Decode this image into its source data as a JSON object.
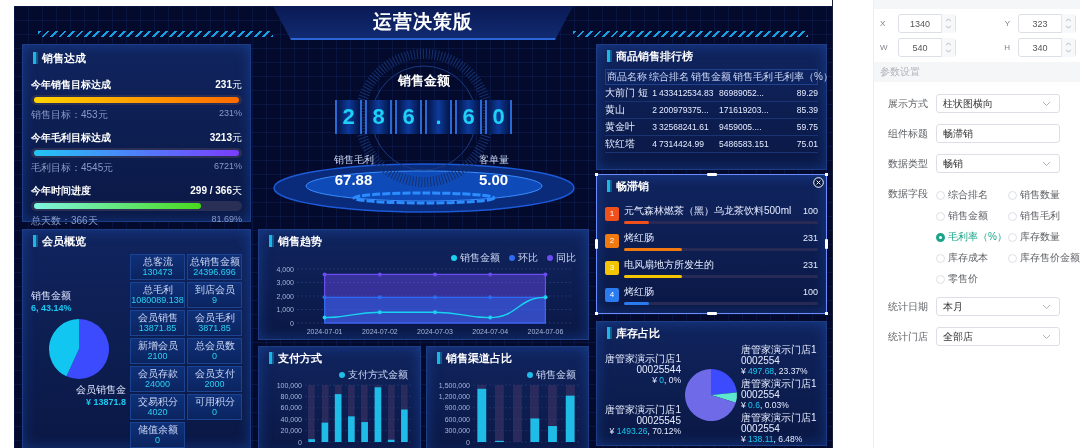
{
  "title": "运营决策版",
  "sales_achievement": {
    "title": "销售达成",
    "items": [
      {
        "kind": "sales",
        "label": "今年销售目标达成",
        "value": "231",
        "unit": "元",
        "target": "销售目标：453元",
        "percent": "231%",
        "level": 1
      },
      {
        "kind": "profit",
        "label": "今年毛利目标达成",
        "value": "3213",
        "unit": "元",
        "target": "毛利目标：4545元",
        "percent": "6721%",
        "level": 1
      },
      {
        "kind": "time",
        "label": "今年时间进度",
        "value": "299 / 366",
        "unit": "天",
        "target": "总天数：366天",
        "percent": "81.69%",
        "level": 0.8169
      }
    ]
  },
  "member_overview": {
    "title": "会员概览",
    "chart_data": {
      "type": "pie",
      "values": [
        56.86,
        43.14
      ]
    },
    "pie_labels": [
      {
        "name": "销售金额",
        "value": "6, 43.14%"
      },
      {
        "name": "会员销售金",
        "value": "¥ 13871.8"
      }
    ],
    "stats": [
      {
        "label": "总客流",
        "value": "130473"
      },
      {
        "label": "总销售金额",
        "value": "24396.696"
      },
      {
        "label": "总毛利",
        "value": "1080089.138"
      },
      {
        "label": "到店会员",
        "value": "9"
      },
      {
        "label": "会员销售",
        "value": "13871.85"
      },
      {
        "label": "会员毛利",
        "value": "3871.85"
      },
      {
        "label": "新增会员",
        "value": "2100"
      },
      {
        "label": "总会员数",
        "value": "0"
      },
      {
        "label": "会员存款",
        "value": "24000"
      },
      {
        "label": "会员支付",
        "value": "2000"
      },
      {
        "label": "交易积分",
        "value": "4020"
      },
      {
        "label": "可用积分",
        "value": "0"
      },
      {
        "label": "储值余额",
        "value": "0"
      }
    ]
  },
  "gauge": {
    "title": "销售金额",
    "digits": [
      "2",
      "8",
      "6",
      ".",
      "6",
      "0"
    ],
    "metrics": [
      {
        "label": "销售毛利",
        "value": "67.88"
      },
      {
        "label": "客单量",
        "value": "5.00"
      }
    ]
  },
  "sales_trend": {
    "title": "销售趋势",
    "chart_data": {
      "type": "area",
      "grid": true,
      "categories": [
        "2024-07-01",
        "2024-07-02",
        "2024-07-03",
        "2024-07-04",
        "2024-07-06"
      ],
      "ylim": [
        0,
        4000
      ],
      "yticks": [
        {
          "value": 0,
          "label": "0"
        },
        {
          "value": 1000,
          "label": "1,000"
        },
        {
          "value": 2000,
          "label": "2,000"
        },
        {
          "value": 3000,
          "label": "3,000"
        },
        {
          "value": 4000,
          "label": "4,000"
        }
      ],
      "series": [
        {
          "name": "销售金额",
          "type": "line",
          "color": "#19d3f0",
          "values": [
            400,
            800,
            800,
            400,
            1900
          ]
        },
        {
          "name": "环比",
          "type": "area",
          "color": "#2f6bf2",
          "values": [
            1900,
            1900,
            1900,
            1900,
            1900
          ]
        },
        {
          "name": "同比",
          "type": "area",
          "color": "#6a4cf0",
          "values": [
            3600,
            3600,
            3600,
            3600,
            3600
          ]
        }
      ]
    }
  },
  "payment": {
    "title": "支付方式",
    "chart_data": {
      "type": "bar",
      "grid": true,
      "ylim": [
        0,
        100000
      ],
      "yticks": [
        {
          "value": 0,
          "label": "0"
        },
        {
          "value": 20000,
          "label": "20,000"
        },
        {
          "value": 40000,
          "label": "40,000"
        },
        {
          "value": 60000,
          "label": "60,000"
        },
        {
          "value": 80000,
          "label": "80,000"
        },
        {
          "value": 100000,
          "label": "100,000"
        }
      ],
      "series": [
        {
          "name": "支付方式金额",
          "color": "#1fbce8",
          "values": [
            5000,
            34000,
            84000,
            45000,
            35000,
            96000,
            4000,
            57000
          ]
        }
      ]
    }
  },
  "channel": {
    "title": "销售渠道占比",
    "chart_data": {
      "type": "bar",
      "grid": true,
      "ylim": [
        0,
        1500000
      ],
      "yticks": [
        {
          "value": 0,
          "label": "0"
        },
        {
          "value": 300000,
          "label": "300,000"
        },
        {
          "value": 600000,
          "label": "600,000"
        },
        {
          "value": 900000,
          "label": "900,000"
        },
        {
          "value": 1200000,
          "label": "1,200,000"
        },
        {
          "value": 1500000,
          "label": "1,500,000"
        }
      ],
      "series": [
        {
          "name": "销售金额",
          "color": "#1fbce8",
          "values": [
            1400000,
            30000,
            0,
            620000,
            420000,
            1220000
          ]
        }
      ]
    }
  },
  "ranking": {
    "title": "商品销售排行榜",
    "columns": [
      "商品名称",
      "综合排名",
      "销售金额",
      "销售毛利",
      "毛利率（%）"
    ],
    "rows": [
      [
        "大前门 短",
        "1",
        "433412534.83",
        "86989052...",
        "89.29"
      ],
      [
        "黄山",
        "2",
        "200979375...",
        "171619203...",
        "85.39"
      ],
      [
        "黄金叶",
        "3",
        "32568241.61",
        "9459005....",
        "59.75"
      ],
      [
        "软红塔",
        "4",
        "7314424.99",
        "5486583.151",
        "75.01"
      ]
    ]
  },
  "bestsellers": {
    "title": "畅滞销",
    "selected": true,
    "items": [
      {
        "rank": "1",
        "name": "元气森林燃茶（黑）乌龙茶饮料500ml",
        "value": "100",
        "level": 0.13,
        "color": "#f0501a"
      },
      {
        "rank": "2",
        "name": "烤红肠",
        "value": "231",
        "level": 0.3,
        "color": "#f07a10"
      },
      {
        "rank": "3",
        "name": "电风扇地方所发生的",
        "value": "231",
        "level": 0.3,
        "color": "#f5c400"
      },
      {
        "rank": "4",
        "name": "烤红肠",
        "value": "100",
        "level": 0.13,
        "color": "#2a7af0"
      }
    ]
  },
  "stock": {
    "title": "库存占比",
    "chart_data": {
      "type": "pie",
      "values": [
        23.37,
        0.03,
        6.48,
        70.12,
        0
      ]
    },
    "left_labels": [
      {
        "store": "唐管家演示门店100025544",
        "currency": "¥ ",
        "amount": "0",
        "share": ", 0%"
      },
      {
        "store": "唐管家演示门店100025545",
        "currency": "¥ ",
        "amount": "1493.26",
        "share": ", 70.12%"
      }
    ],
    "right_labels": [
      {
        "store": "唐管家演示门店10002554",
        "currency": "¥ ",
        "amount": "497.68",
        "share": ", 23.37%"
      },
      {
        "store": "唐管家演示门店10002554",
        "currency": "¥ ",
        "amount": "0.6",
        "share": ", 0.03%"
      },
      {
        "store": "唐管家演示门店10002554",
        "currency": "¥ ",
        "amount": "138.11",
        "share": ", 6.48%"
      }
    ]
  },
  "settings": {
    "position": [
      {
        "label": "X",
        "value": "1340"
      },
      {
        "label": "Y",
        "value": "323"
      },
      {
        "label": "W",
        "value": "540"
      },
      {
        "label": "H",
        "value": "340"
      }
    ],
    "section": "参数设置",
    "fields": [
      {
        "kind": "select",
        "label": "展示方式",
        "value": "柱状图横向"
      },
      {
        "kind": "input",
        "label": "组件标题",
        "value": "畅滞销"
      },
      {
        "kind": "select",
        "label": "数据类型",
        "value": "畅销"
      },
      {
        "kind": "radio",
        "label": "数据字段",
        "options": [
          {
            "label": "综合排名",
            "selected": false
          },
          {
            "label": "销售数量",
            "selected": false
          },
          {
            "label": "销售金额",
            "selected": false
          },
          {
            "label": "销售毛利",
            "selected": false
          },
          {
            "label": "毛利率（%）",
            "selected": true
          },
          {
            "label": "库存数量",
            "selected": false
          },
          {
            "label": "库存成本",
            "selected": false
          },
          {
            "label": "库存售价金额",
            "selected": false
          },
          {
            "label": "零售价",
            "selected": false
          }
        ]
      },
      {
        "kind": "select",
        "label": "统计日期",
        "value": "本月"
      },
      {
        "kind": "select",
        "label": "统计门店",
        "value": "全部店"
      }
    ]
  }
}
